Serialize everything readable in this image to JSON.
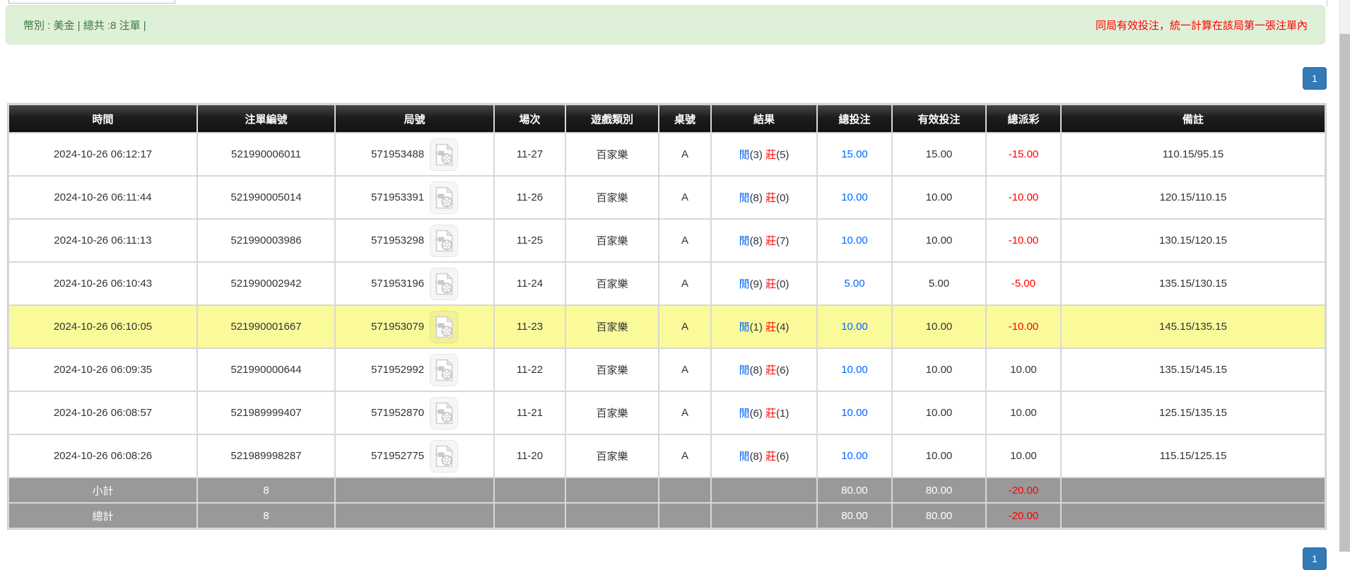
{
  "banner": {
    "currency_label": "幣別 : 美金 | 總共 :8 注單 |",
    "notice": "同局有效投注，統一計算在該局第一張注單內"
  },
  "pagination": {
    "page_top": "1",
    "page_bottom": "1"
  },
  "icons": {
    "video_replay": "video-file-icon"
  },
  "colors": {
    "banner_bg": "#dff0d8",
    "banner_text": "#3c763d",
    "notice_red": "#ff0000",
    "link_blue": "#0066ff",
    "banker_red": "#ff0000",
    "highlight_yellow": "#fafa9b",
    "header_dark": "#1a1a1a",
    "footer_gray": "#999999",
    "pagination_blue": "#337ab7"
  },
  "table": {
    "headers": [
      "時間",
      "注單編號",
      "局號",
      "場次",
      "遊戲類別",
      "桌號",
      "結果",
      "總投注",
      "有效投注",
      "總派彩",
      "備註"
    ],
    "rows": [
      {
        "time": "2024-10-26 06:12:17",
        "bet_id": "521990006011",
        "round": "571953488",
        "session": "11-27",
        "game_type": "百家樂",
        "table_no": "A",
        "player_label": "閒",
        "player_score": "(3)",
        "banker_label": "莊",
        "banker_score": "(5)",
        "total_bet": "15.00",
        "valid_bet": "15.00",
        "payout": "-15.00",
        "remark": "110.15/95.15",
        "highlighted": false
      },
      {
        "time": "2024-10-26 06:11:44",
        "bet_id": "521990005014",
        "round": "571953391",
        "session": "11-26",
        "game_type": "百家樂",
        "table_no": "A",
        "player_label": "閒",
        "player_score": "(8)",
        "banker_label": "莊",
        "banker_score": "(0)",
        "total_bet": "10.00",
        "valid_bet": "10.00",
        "payout": "-10.00",
        "remark": "120.15/110.15",
        "highlighted": false
      },
      {
        "time": "2024-10-26 06:11:13",
        "bet_id": "521990003986",
        "round": "571953298",
        "session": "11-25",
        "game_type": "百家樂",
        "table_no": "A",
        "player_label": "閒",
        "player_score": "(8)",
        "banker_label": "莊",
        "banker_score": "(7)",
        "total_bet": "10.00",
        "valid_bet": "10.00",
        "payout": "-10.00",
        "remark": "130.15/120.15",
        "highlighted": false
      },
      {
        "time": "2024-10-26 06:10:43",
        "bet_id": "521990002942",
        "round": "571953196",
        "session": "11-24",
        "game_type": "百家樂",
        "table_no": "A",
        "player_label": "閒",
        "player_score": "(9)",
        "banker_label": "莊",
        "banker_score": "(0)",
        "total_bet": "5.00",
        "valid_bet": "5.00",
        "payout": "-5.00",
        "remark": "135.15/130.15",
        "highlighted": false
      },
      {
        "time": "2024-10-26 06:10:05",
        "bet_id": "521990001667",
        "round": "571953079",
        "session": "11-23",
        "game_type": "百家樂",
        "table_no": "A",
        "player_label": "閒",
        "player_score": "(1)",
        "banker_label": "莊",
        "banker_score": "(4)",
        "total_bet": "10.00",
        "valid_bet": "10.00",
        "payout": "-10.00",
        "remark": "145.15/135.15",
        "highlighted": true
      },
      {
        "time": "2024-10-26 06:09:35",
        "bet_id": "521990000644",
        "round": "571952992",
        "session": "11-22",
        "game_type": "百家樂",
        "table_no": "A",
        "player_label": "閒",
        "player_score": "(8)",
        "banker_label": "莊",
        "banker_score": "(6)",
        "total_bet": "10.00",
        "valid_bet": "10.00",
        "payout": "10.00",
        "remark": "135.15/145.15",
        "highlighted": false
      },
      {
        "time": "2024-10-26 06:08:57",
        "bet_id": "521989999407",
        "round": "571952870",
        "session": "11-21",
        "game_type": "百家樂",
        "table_no": "A",
        "player_label": "閒",
        "player_score": "(6)",
        "banker_label": "莊",
        "banker_score": "(1)",
        "total_bet": "10.00",
        "valid_bet": "10.00",
        "payout": "10.00",
        "remark": "125.15/135.15",
        "highlighted": false
      },
      {
        "time": "2024-10-26 06:08:26",
        "bet_id": "521989998287",
        "round": "571952775",
        "session": "11-20",
        "game_type": "百家樂",
        "table_no": "A",
        "player_label": "閒",
        "player_score": "(8)",
        "banker_label": "莊",
        "banker_score": "(6)",
        "total_bet": "10.00",
        "valid_bet": "10.00",
        "payout": "10.00",
        "remark": "115.15/125.15",
        "highlighted": false
      }
    ],
    "footer": {
      "subtotal": {
        "label": "小計",
        "count": "8",
        "total_bet": "80.00",
        "valid_bet": "80.00",
        "payout": "-20.00"
      },
      "total": {
        "label": "總計",
        "count": "8",
        "total_bet": "80.00",
        "valid_bet": "80.00",
        "payout": "-20.00"
      }
    }
  }
}
